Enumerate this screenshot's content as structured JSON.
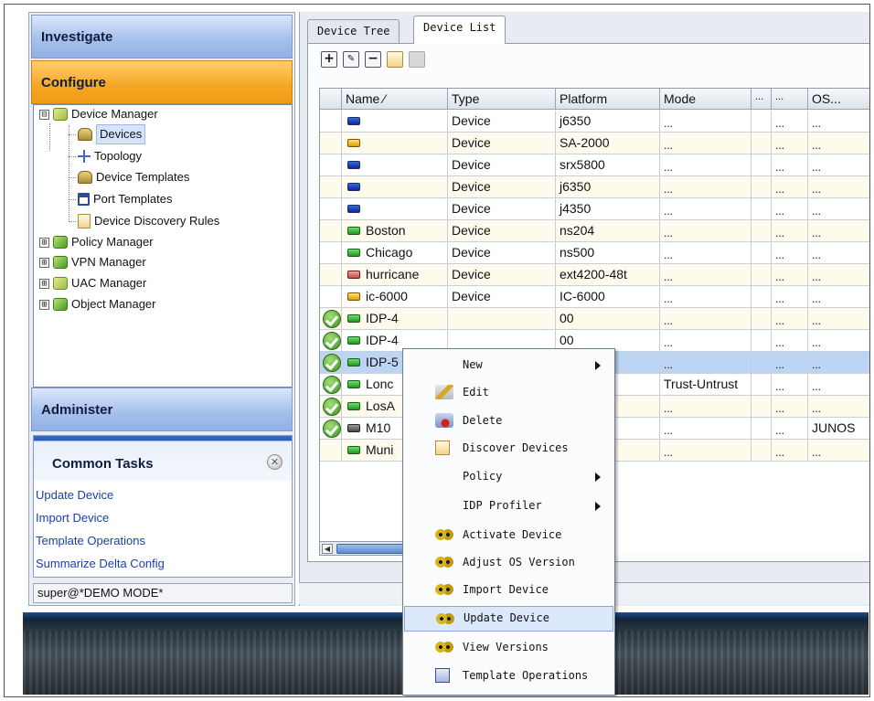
{
  "nav": {
    "investigate": "Investigate",
    "configure": "Configure",
    "administer": "Administer"
  },
  "tree": [
    {
      "label": "Device Manager",
      "expander": "⊟",
      "icon": "device-manager-icon"
    },
    {
      "label": "Devices",
      "icon": "devices-icon",
      "selected": true
    },
    {
      "label": "Topology",
      "icon": "topology-icon"
    },
    {
      "label": "Device Templates",
      "icon": "device-templates-icon"
    },
    {
      "label": "Port Templates",
      "icon": "port-templates-icon"
    },
    {
      "label": "Device Discovery Rules",
      "icon": "discovery-rules-icon"
    },
    {
      "label": "Policy Manager",
      "expander": "⊞",
      "icon": "policy-manager-icon"
    },
    {
      "label": "VPN Manager",
      "expander": "⊞",
      "icon": "vpn-manager-icon"
    },
    {
      "label": "UAC Manager",
      "expander": "⊞",
      "icon": "uac-manager-icon"
    },
    {
      "label": "Object Manager",
      "expander": "⊞",
      "icon": "object-manager-icon"
    }
  ],
  "common_tasks": {
    "title": "Common Tasks",
    "close_glyph": "✕",
    "links": [
      "Update Device",
      "Import Device",
      "Template Operations",
      "Summarize Delta Config"
    ]
  },
  "status": {
    "user": "super@*DEMO MODE*"
  },
  "tabs": [
    "Device Tree",
    "Device List"
  ],
  "toolbar": {
    "add": "+",
    "remove": "−"
  },
  "grid": {
    "columns": [
      "Name ⁄",
      "Type",
      "Platform",
      "Mode",
      "...",
      "...",
      "OS..."
    ],
    "rows": [
      {
        "name": "",
        "type": "Device",
        "platform": "j6350",
        "mode": "...",
        "c5": "",
        "c6": "...",
        "os": "...",
        "icon": "blue",
        "check": false,
        "style": "norm"
      },
      {
        "name": "",
        "type": "Device",
        "platform": "SA-2000",
        "mode": "...",
        "c5": "",
        "c6": "...",
        "os": "...",
        "icon": "yellow",
        "check": false,
        "style": "alt"
      },
      {
        "name": "",
        "type": "Device",
        "platform": "srx5800",
        "mode": "...",
        "c5": "",
        "c6": "...",
        "os": "...",
        "icon": "blue",
        "check": false,
        "style": "norm"
      },
      {
        "name": "",
        "type": "Device",
        "platform": "j6350",
        "mode": "...",
        "c5": "",
        "c6": "...",
        "os": "...",
        "icon": "blue",
        "check": false,
        "style": "alt"
      },
      {
        "name": "",
        "type": "Device",
        "platform": "j4350",
        "mode": "...",
        "c5": "",
        "c6": "...",
        "os": "...",
        "icon": "blue",
        "check": false,
        "style": "norm"
      },
      {
        "name": "Boston",
        "type": "Device",
        "platform": "ns204",
        "mode": "...",
        "c5": "",
        "c6": "...",
        "os": "...",
        "icon": "green",
        "check": false,
        "style": "alt"
      },
      {
        "name": "Chicago",
        "type": "Device",
        "platform": "ns500",
        "mode": "...",
        "c5": "",
        "c6": "...",
        "os": "...",
        "icon": "green",
        "check": false,
        "style": "norm"
      },
      {
        "name": "hurricane",
        "type": "Device",
        "platform": "ext4200-48t",
        "mode": "...",
        "c5": "",
        "c6": "...",
        "os": "...",
        "icon": "red",
        "check": false,
        "style": "alt"
      },
      {
        "name": "ic-6000",
        "type": "Device",
        "platform": "IC-6000",
        "mode": "...",
        "c5": "",
        "c6": "...",
        "os": "...",
        "icon": "yellow",
        "check": false,
        "style": "norm"
      },
      {
        "name": "IDP-4",
        "type": "",
        "platform": "00",
        "mode": "...",
        "c5": "",
        "c6": "...",
        "os": "...",
        "icon": "green",
        "check": true,
        "style": "alt"
      },
      {
        "name": "IDP-4",
        "type": "",
        "platform": "00",
        "mode": "...",
        "c5": "",
        "c6": "...",
        "os": "...",
        "icon": "green",
        "check": true,
        "style": "norm"
      },
      {
        "name": "IDP-5",
        "type": "",
        "platform": "00",
        "mode": "...",
        "c5": "",
        "c6": "...",
        "os": "...",
        "icon": "green",
        "check": true,
        "style": "sel"
      },
      {
        "name": "Lonc",
        "type": "",
        "platform": "",
        "mode": "Trust-Untrust",
        "c5": "",
        "c6": "...",
        "os": "...",
        "icon": "green",
        "check": true,
        "style": "norm"
      },
      {
        "name": "LosA",
        "type": "",
        "platform": "",
        "mode": "...",
        "c5": "",
        "c6": "...",
        "os": "...",
        "icon": "green",
        "check": true,
        "style": "alt"
      },
      {
        "name": "M10",
        "type": "",
        "platform": "",
        "mode": "...",
        "c5": "",
        "c6": "...",
        "os": "JUNOS",
        "icon": "gray",
        "check": true,
        "style": "norm"
      },
      {
        "name": "Muni",
        "type": "",
        "platform": "",
        "mode": "...",
        "c5": "",
        "c6": "...",
        "os": "...",
        "icon": "green",
        "check": false,
        "style": "alt"
      }
    ]
  },
  "scroll_arrow": "◀",
  "context_menu": [
    {
      "label": "New",
      "submenu": true,
      "icon": ""
    },
    {
      "label": "Edit",
      "submenu": false,
      "icon": "edit-icon"
    },
    {
      "label": "Delete",
      "submenu": false,
      "icon": "delete-icon"
    },
    {
      "label": "Discover Devices",
      "submenu": false,
      "icon": "discover-devices-icon"
    },
    {
      "label": "Policy",
      "submenu": true,
      "icon": ""
    },
    {
      "label": "IDP Profiler",
      "submenu": true,
      "icon": ""
    },
    {
      "label": "Activate Device",
      "submenu": false,
      "icon": "gears-icon"
    },
    {
      "label": "Adjust OS Version",
      "submenu": false,
      "icon": "gears-icon"
    },
    {
      "label": "Import Device",
      "submenu": false,
      "icon": "gears-icon"
    },
    {
      "label": "Update Device",
      "submenu": false,
      "icon": "gears-icon",
      "highlighted": true
    },
    {
      "label": "View Versions",
      "submenu": false,
      "icon": "gears-icon"
    },
    {
      "label": "Template Operations",
      "submenu": false,
      "icon": "template-operations-icon"
    }
  ]
}
